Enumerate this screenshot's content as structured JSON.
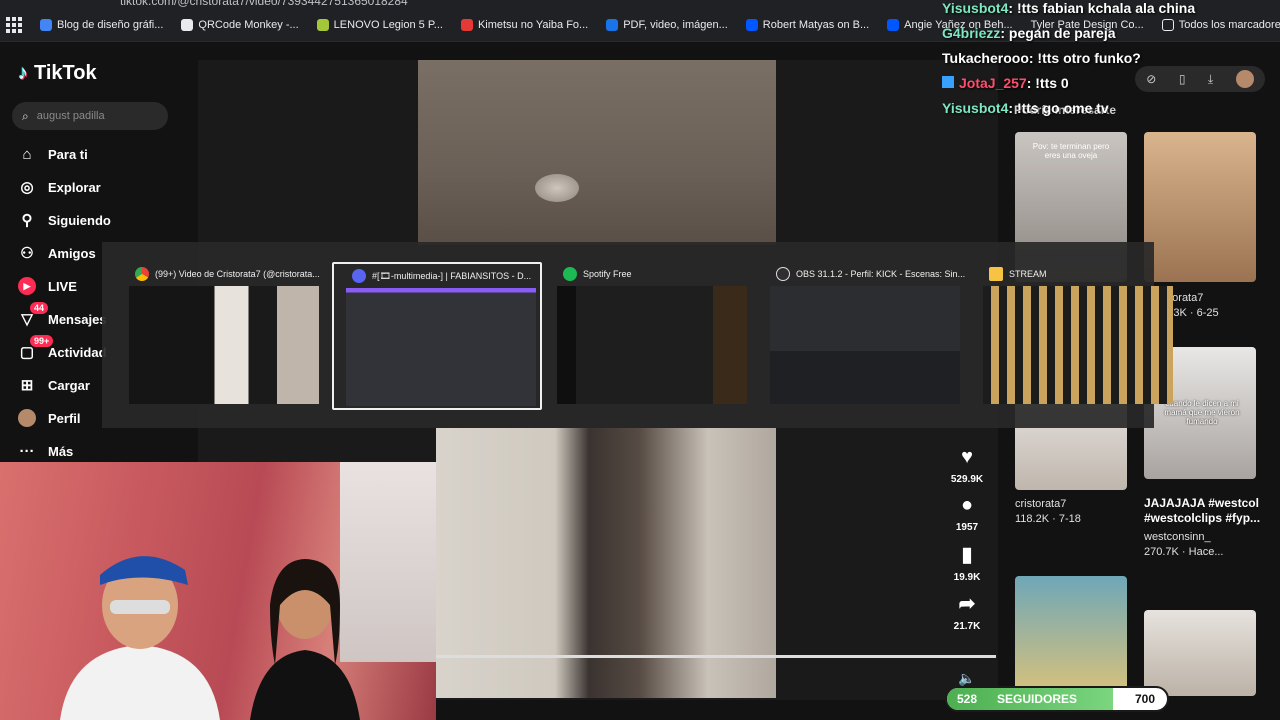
{
  "browser": {
    "url": "tiktok.com/@cristorata7/video/7393442751365018284",
    "bookmarks": [
      {
        "label": "Blog de diseño gráfi...",
        "color": "#4285f4"
      },
      {
        "label": "QRCode Monkey -...",
        "color": "#e8eaed"
      },
      {
        "label": "LENOVO Legion 5 P...",
        "color": "#a4c639"
      },
      {
        "label": "Kimetsu no Yaiba Fo...",
        "color": "#e53935"
      },
      {
        "label": "PDF, video, imágen...",
        "color": "#1a73e8"
      },
      {
        "label": "Robert Matyas on B...",
        "color": "#0057ff"
      },
      {
        "label": "Angie Yañez on Beh...",
        "color": "#0057ff"
      },
      {
        "label": "Tyler Pate Design Co...",
        "color": "#444"
      }
    ],
    "all_bookmarks_label": "Todos los marcadores"
  },
  "tiktok": {
    "logo": "TikTok",
    "search_placeholder": "august padilla",
    "nav": [
      {
        "label": "Para ti",
        "icon": "home-icon"
      },
      {
        "label": "Explorar",
        "icon": "compass-icon"
      },
      {
        "label": "Siguiendo",
        "icon": "following-icon"
      },
      {
        "label": "Amigos",
        "icon": "friends-icon"
      },
      {
        "label": "LIVE",
        "icon": "live-icon"
      },
      {
        "label": "Mensajes",
        "icon": "messages-icon",
        "badge": "44"
      },
      {
        "label": "Actividad",
        "icon": "activity-icon",
        "badge": "99+"
      },
      {
        "label": "Cargar",
        "icon": "upload-icon"
      },
      {
        "label": "Perfil",
        "icon": "avatar-icon"
      },
      {
        "label": "Más",
        "icon": "more-icon"
      }
    ],
    "actions": [
      {
        "icon": "heart-icon",
        "count": "529.9K"
      },
      {
        "icon": "comment-icon",
        "count": "1957"
      },
      {
        "icon": "bookmark-icon",
        "count": "19.9K"
      },
      {
        "icon": "share-icon",
        "count": "21.7K"
      }
    ],
    "right_panel": {
      "heading": "Podría interesarte",
      "items": [
        {
          "overlay": "Pov: te terminan pero eres una oveja",
          "author": "",
          "stats": ""
        },
        {
          "overlay": "",
          "author": "cristorata7",
          "stats": "167.3K · 6-25"
        },
        {
          "overlay": "",
          "author": "cristorata7",
          "stats": "118.2K · 7-18"
        },
        {
          "overlay": "cuando le dicen a mi mamá que me vieron fumando",
          "title": "JAJAJAJA #westcol #westcolclips #fyp...",
          "author": "westconsinn_",
          "stats": "270.7K · Hace..."
        }
      ]
    }
  },
  "task_switcher": {
    "windows": [
      {
        "title": "(99+) Video de Cristorata7 (@cristorata...",
        "icon": "chrome-icon",
        "icon_color": "#e8453c"
      },
      {
        "title": "#[🎞-multimedia-] | FABIANSITOS - D...",
        "icon": "discord-icon",
        "icon_color": "#5865f2"
      },
      {
        "title": "Spotify Free",
        "icon": "spotify-icon",
        "icon_color": "#1db954"
      },
      {
        "title": "OBS 31.1.2 - Perfil: KICK - Escenas: Sin...",
        "icon": "obs-icon",
        "icon_color": "#302e31"
      },
      {
        "title": "STREAM",
        "icon": "folder-icon",
        "icon_color": "#f6c343"
      }
    ]
  },
  "chat": [
    {
      "user": "Yisusbot4",
      "message": ": !tts fabian kchala ala china",
      "color": "#7ee8c2"
    },
    {
      "user": "G4briezz",
      "message": ": pegan de pareja",
      "color": "#7ee8c2"
    },
    {
      "user": "Tukacherooo",
      "message": ": !tts otro funko?",
      "color": "#ffffff"
    },
    {
      "user": "JotaJ_257",
      "message": ": !tts 0",
      "color": "#ff4d6d"
    },
    {
      "user": "Yisusbot4",
      "message": ": !tts go ome tv",
      "color": "#7ee8c2"
    }
  ],
  "followers": {
    "label": "SEGUIDORES",
    "current": "528",
    "goal": "700",
    "progress": 0.754
  }
}
